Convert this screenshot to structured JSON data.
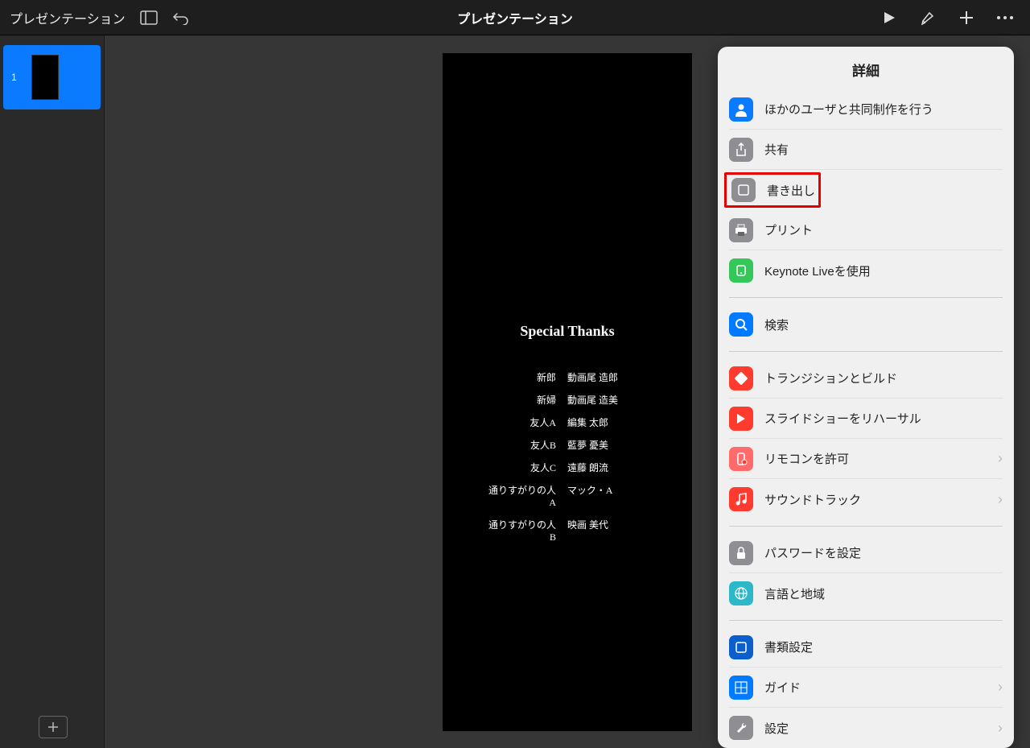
{
  "toolbar": {
    "back": "プレゼンテーション",
    "title": "プレゼンテーション"
  },
  "sidebar": {
    "slide_number": "1"
  },
  "slide": {
    "title": "Special Thanks",
    "credits": [
      {
        "role": "新郎",
        "name": "動画尾 造郎"
      },
      {
        "role": "新婦",
        "name": "動画尾 造美"
      },
      {
        "role": "友人A",
        "name": "編集 太郎"
      },
      {
        "role": "友人B",
        "name": "藍夢 憂美"
      },
      {
        "role": "友人C",
        "name": "遠藤 朗流"
      },
      {
        "role": "通りすがりの人A",
        "name": "マック・A"
      },
      {
        "role": "通りすがりの人B",
        "name": "映画 美代"
      }
    ]
  },
  "popover": {
    "title": "詳細",
    "items": {
      "collab": "ほかのユーザと共同制作を行う",
      "share": "共有",
      "export": "書き出し",
      "print": "プリント",
      "keynote_live": "Keynote Liveを使用",
      "search": "検索",
      "transitions": "トランジションとビルド",
      "rehearse": "スライドショーをリハーサル",
      "remote": "リモコンを許可",
      "soundtrack": "サウンドトラック",
      "password": "パスワードを設定",
      "language": "言語と地域",
      "doc_setup": "書類設定",
      "guides": "ガイド",
      "settings": "設定"
    }
  }
}
